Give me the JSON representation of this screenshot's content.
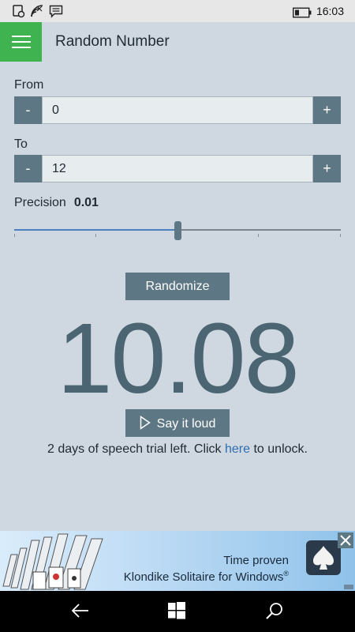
{
  "status_bar": {
    "time": "16:03",
    "icons": [
      "notification-icon",
      "wifi-icon",
      "message-icon",
      "battery-icon"
    ]
  },
  "app": {
    "title": "Random Number",
    "menu_icon": "hamburger-icon",
    "accent_color": "#3fb34f"
  },
  "from": {
    "label": "From",
    "value": "0",
    "minus_label": "-",
    "plus_label": "+"
  },
  "to": {
    "label": "To",
    "value": "12",
    "minus_label": "-",
    "plus_label": "+"
  },
  "precision": {
    "label": "Precision",
    "value": "0.01",
    "slider_fraction": 0.5
  },
  "randomize_label": "Randomize",
  "result": "10.08",
  "say_label": "Say it loud",
  "say_icon": "play-icon",
  "trial": {
    "before": "2 days of speech trial left. Click ",
    "link": "here",
    "after": " to unlock."
  },
  "ad": {
    "line1": "Time proven",
    "line2": "Klondike Solitaire for Windows",
    "registered": "®"
  },
  "nav": [
    "back-icon",
    "windows-icon",
    "search-icon"
  ]
}
